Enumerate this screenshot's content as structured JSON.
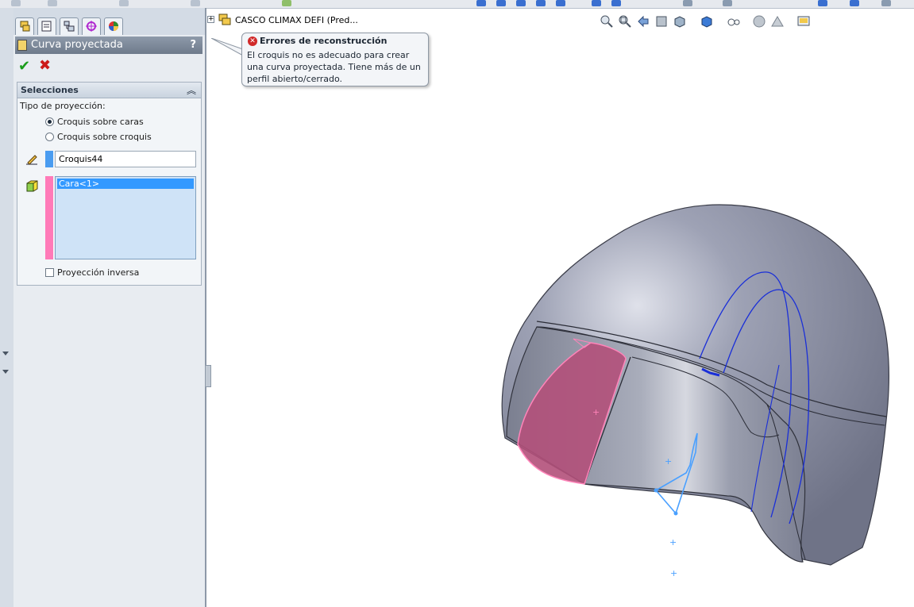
{
  "property_manager": {
    "title": "Curva proyectada",
    "help": "?",
    "ok_icon": "checkmark-icon",
    "cancel_icon": "cross-icon",
    "selections": {
      "header": "Selecciones",
      "projection_type_label": "Tipo de proyección:",
      "radio_options": [
        {
          "label": "Croquis sobre caras",
          "selected": true
        },
        {
          "label": "Croquis sobre croquis",
          "selected": false
        }
      ],
      "sketch_field_value": "Croquis44",
      "faces_list": [
        "Cara<1>"
      ],
      "reverse_projection_label": "Proyección inversa",
      "reverse_projection_checked": false
    }
  },
  "feature_tree": {
    "part_name": "CASCO CLIMAX DEFI  (Pred..."
  },
  "error_tooltip": {
    "title": "Errores de reconstrucción",
    "message": "El croquis no es adecuado para crear una curva proyectada. Tiene más de un perfil abierto/cerrado."
  },
  "colors": {
    "sketch_bar": "#4a9cf0",
    "faces_bar": "#ff7ab8",
    "helmet_shell": "#8a8ea3",
    "selected_face": "#b2507a",
    "sketch_curve_blue": "#1a2fd8",
    "open_sketch_lightblue": "#4aa0ff"
  }
}
